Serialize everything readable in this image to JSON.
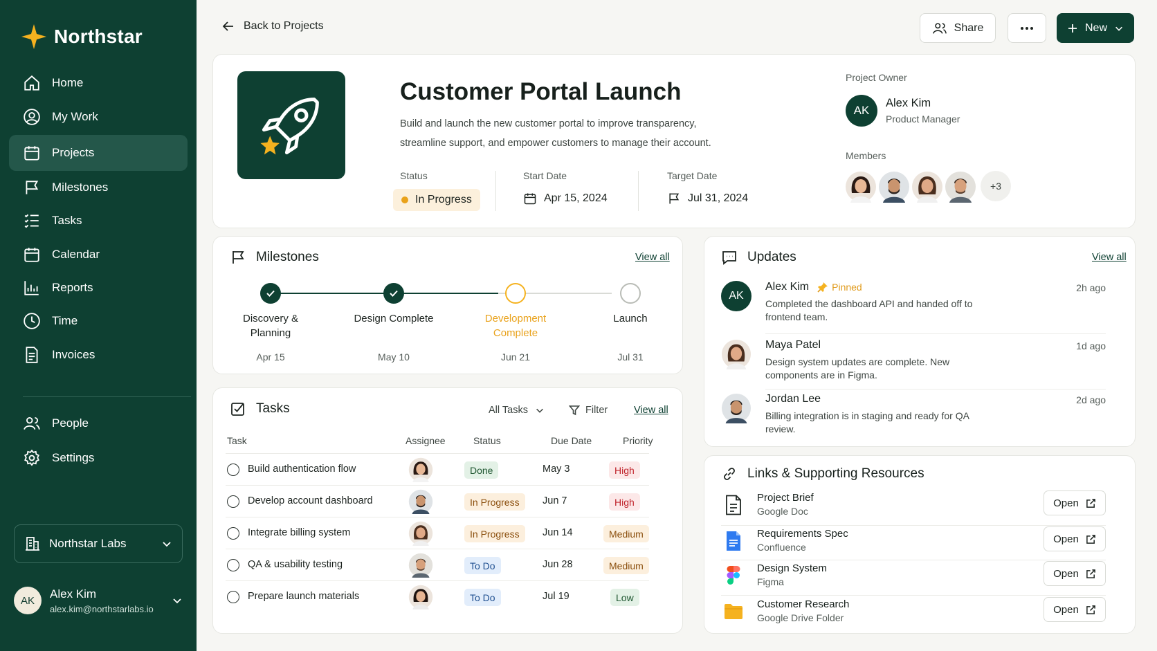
{
  "app": {
    "name": "Northstar"
  },
  "sidebar": {
    "items": [
      {
        "label": "Home",
        "icon": "home-icon"
      },
      {
        "label": "My Work",
        "icon": "user-circle-icon"
      },
      {
        "label": "Projects",
        "icon": "calendar-icon",
        "active": true
      },
      {
        "label": "Milestones",
        "icon": "flag-icon"
      },
      {
        "label": "Tasks",
        "icon": "list-icon"
      },
      {
        "label": "Calendar",
        "icon": "calendar-icon"
      },
      {
        "label": "Reports",
        "icon": "chart-icon"
      },
      {
        "label": "Time",
        "icon": "clock-icon"
      },
      {
        "label": "Invoices",
        "icon": "invoice-icon"
      }
    ],
    "secondary": [
      {
        "label": "People",
        "icon": "people-icon"
      },
      {
        "label": "Settings",
        "icon": "gear-icon"
      }
    ],
    "org": "Northstar Labs",
    "user": {
      "initials": "AK",
      "name": "Alex Kim",
      "email": "alex.kim@northstarlabs.io"
    }
  },
  "header": {
    "back_label": "Back to Projects",
    "share_label": "Share",
    "new_label": "New"
  },
  "project": {
    "title": "Customer Portal Launch",
    "description": "Build and launch the new customer portal to improve transparency, streamline support, and empower customers to manage their account.",
    "status_label": "Status",
    "status": "In Progress",
    "start_label": "Start Date",
    "start": "Apr 15, 2024",
    "target_label": "Target Date",
    "target": "Jul 31, 2024",
    "owner_label": "Project Owner",
    "owner": {
      "initials": "AK",
      "name": "Alex Kim",
      "role": "Product Manager"
    },
    "members_label": "Members",
    "members_more": "+3"
  },
  "milestones": {
    "title": "Milestones",
    "view_all": "View all",
    "items": [
      {
        "name": "Discovery & Planning",
        "date": "Apr 15",
        "state": "done"
      },
      {
        "name": "Design Complete",
        "date": "May 10",
        "state": "done"
      },
      {
        "name": "Development Complete",
        "date": "Jun 21",
        "state": "current"
      },
      {
        "name": "Launch",
        "date": "Jul 31",
        "state": "upcoming"
      }
    ]
  },
  "tasks": {
    "title": "Tasks",
    "filter_select": "All Tasks",
    "filter_label": "Filter",
    "view_all": "View all",
    "columns": [
      "Task",
      "Assignee",
      "Status",
      "Due Date",
      "Priority"
    ],
    "rows": [
      {
        "task": "Build authentication flow",
        "status": "Done",
        "due": "May 3",
        "priority": "High"
      },
      {
        "task": "Develop account dashboard",
        "status": "In Progress",
        "due": "Jun 7",
        "priority": "High"
      },
      {
        "task": "Integrate billing system",
        "status": "In Progress",
        "due": "Jun 14",
        "priority": "Medium"
      },
      {
        "task": "QA & usability testing",
        "status": "To Do",
        "due": "Jun 28",
        "priority": "Medium"
      },
      {
        "task": "Prepare launch materials",
        "status": "To Do",
        "due": "Jul 19",
        "priority": "Low"
      }
    ]
  },
  "updates": {
    "title": "Updates",
    "view_all": "View all",
    "pinned_label": "Pinned",
    "items": [
      {
        "initials": "AK",
        "name": "Alex Kim",
        "text": "Completed the dashboard API and handed off to frontend team.",
        "time": "2h ago"
      },
      {
        "name": "Maya Patel",
        "text": "Design system updates are complete. New components are in Figma.",
        "time": "1d ago"
      },
      {
        "name": "Jordan Lee",
        "text": "Billing integration is in staging and ready for QA review.",
        "time": "2d ago"
      }
    ]
  },
  "resources": {
    "title": "Links & Supporting Resources",
    "open_label": "Open",
    "items": [
      {
        "name": "Project Brief",
        "source": "Google Doc"
      },
      {
        "name": "Requirements Spec",
        "source": "Confluence"
      },
      {
        "name": "Design System",
        "source": "Figma"
      },
      {
        "name": "Customer Research",
        "source": "Google Drive Folder"
      }
    ]
  },
  "colors": {
    "brand": "#0e4032",
    "accent": "#f5b21f",
    "in_progress": "#e9a21b"
  }
}
